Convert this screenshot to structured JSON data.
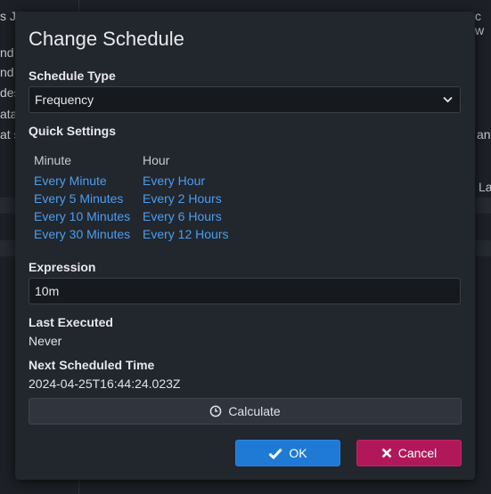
{
  "background": {
    "rows": [
      "s Ja",
      "nd t",
      "nd i",
      "des",
      "ata",
      "at s"
    ],
    "right_top": "c w",
    "right_mid": "an",
    "right_low": "La"
  },
  "dialog": {
    "title": "Change Schedule",
    "schedule_type_label": "Schedule Type",
    "schedule_type_value": "Frequency",
    "quick_settings_label": "Quick Settings",
    "minute_header": "Minute",
    "hour_header": "Hour",
    "minute_options": [
      "Every Minute",
      "Every 5 Minutes",
      "Every 10 Minutes",
      "Every 30 Minutes"
    ],
    "hour_options": [
      "Every Hour",
      "Every 2 Hours",
      "Every 6 Hours",
      "Every 12 Hours"
    ],
    "expression_label": "Expression",
    "expression_value": "10m",
    "last_executed_label": "Last Executed",
    "last_executed_value": "Never",
    "next_scheduled_label": "Next Scheduled Time",
    "next_scheduled_value": "2024-04-25T16:44:24.023Z",
    "calculate_label": "Calculate",
    "ok_label": "OK",
    "cancel_label": "Cancel"
  },
  "icons": {
    "select": "chevron-down-icon",
    "calculate": "clock-icon",
    "ok": "check-icon",
    "cancel": "close-icon"
  },
  "colors": {
    "link": "#4a9ff0",
    "ok": "#1f7ad6",
    "cancel": "#b0185a"
  }
}
